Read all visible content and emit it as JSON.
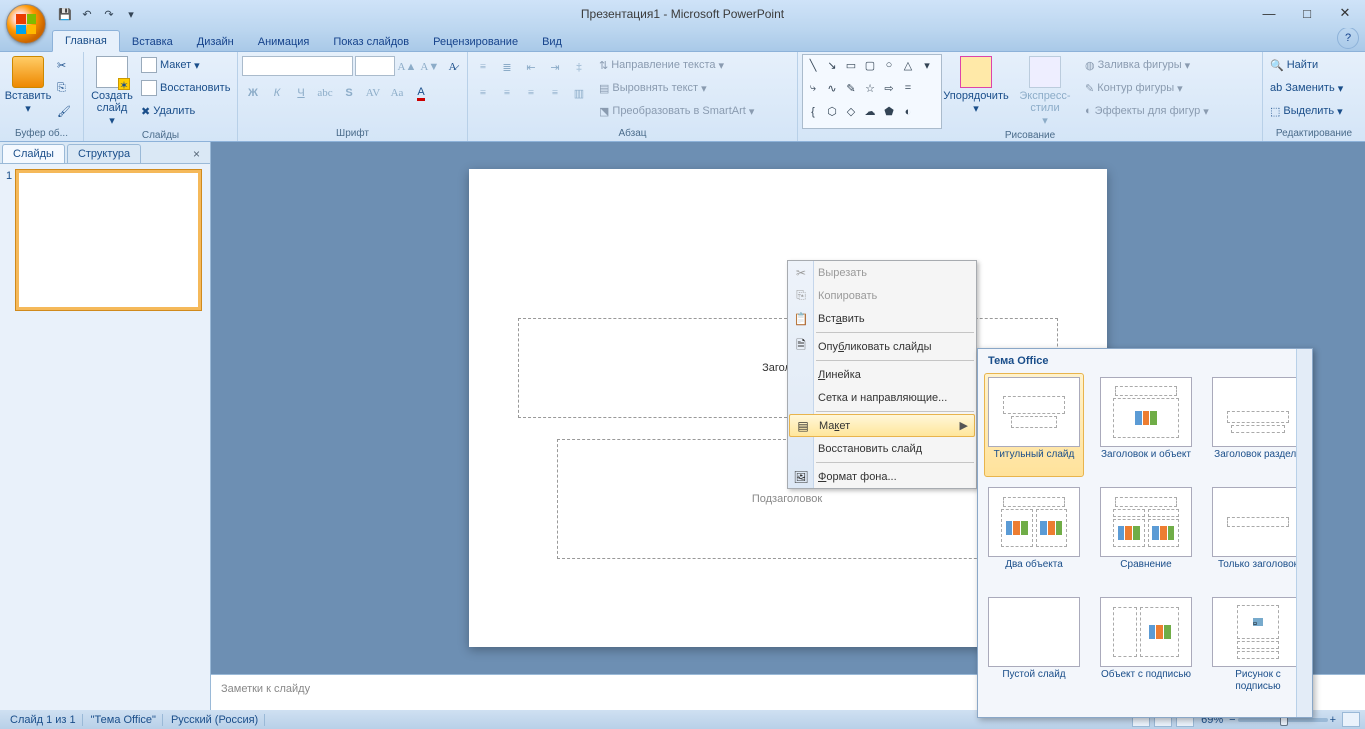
{
  "title": "Презентация1 - Microsoft PowerPoint",
  "tabs": {
    "home": "Главная",
    "insert": "Вставка",
    "design": "Дизайн",
    "anim": "Анимация",
    "slideshow": "Показ слайдов",
    "review": "Рецензирование",
    "view": "Вид"
  },
  "ribbon": {
    "clipboard": {
      "paste": "Вставить",
      "label": "Буфер об..."
    },
    "slides": {
      "new": "Создать слайд",
      "layout": "Макет",
      "reset": "Восстановить",
      "delete": "Удалить",
      "label": "Слайды"
    },
    "font": {
      "label": "Шрифт"
    },
    "para": {
      "label": "Абзац",
      "textdir": "Направление текста",
      "align": "Выровнять текст",
      "smartart": "Преобразовать в SmartArt"
    },
    "draw": {
      "arrange": "Упорядочить",
      "styles": "Экспресс-стили",
      "fill": "Заливка фигуры",
      "outline": "Контур фигуры",
      "effects": "Эффекты для фигур",
      "label": "Рисование"
    },
    "edit": {
      "find": "Найти",
      "replace": "Заменить",
      "select": "Выделить",
      "label": "Редактирование"
    }
  },
  "left": {
    "slides": "Слайды",
    "outline": "Структура",
    "num": "1"
  },
  "slide": {
    "title": "Заголовок",
    "sub": "Подзаголовок"
  },
  "notes": "Заметки к слайду",
  "ctx": {
    "cut": "Вырезать",
    "copy": "Копировать",
    "paste": "Вставить",
    "publish": "Опубликовать слайды",
    "ruler": "Линейка",
    "grid": "Сетка и направляющие...",
    "layout": "Макет",
    "reset": "Восстановить слайд",
    "bgformat": "Формат фона..."
  },
  "fly": {
    "header": "Тема Office",
    "l1": "Титульный слайд",
    "l2": "Заголовок и объект",
    "l3": "Заголовок раздела",
    "l4": "Два объекта",
    "l5": "Сравнение",
    "l6": "Только заголовок",
    "l7": "Пустой слайд",
    "l8": "Объект с подписью",
    "l9": "Рисунок с подписью"
  },
  "status": {
    "slide": "Слайд 1 из 1",
    "theme": "\"Тема Office\"",
    "lang": "Русский (Россия)",
    "zoom": "69%"
  }
}
